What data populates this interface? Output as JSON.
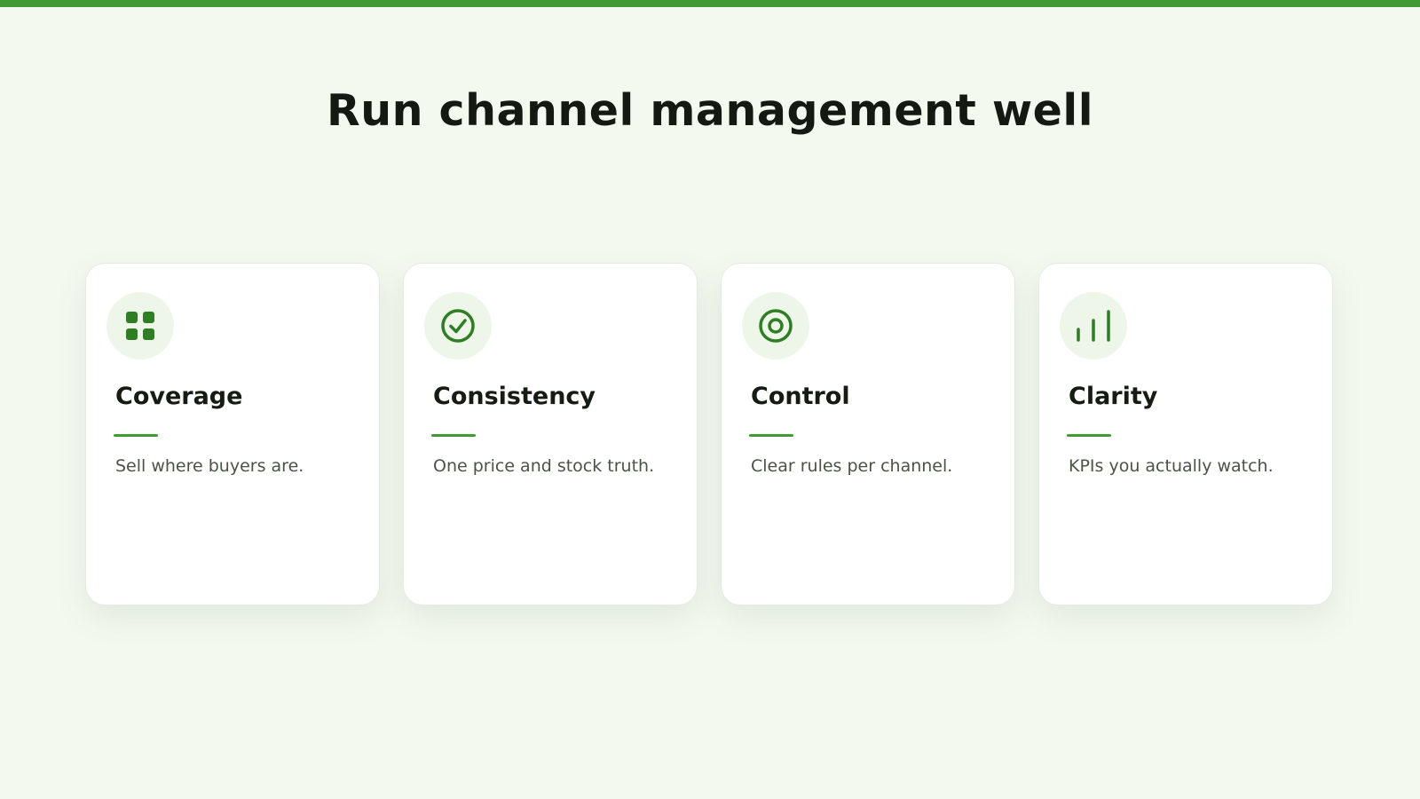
{
  "page": {
    "title": "Run channel management well",
    "accent_color": "#3f9b32"
  },
  "cards": [
    {
      "icon": "grid-icon",
      "title": "Coverage",
      "description": "Sell where buyers are."
    },
    {
      "icon": "check-circle-icon",
      "title": "Consistency",
      "description": "One price and stock truth."
    },
    {
      "icon": "target-icon",
      "title": "Control",
      "description": "Clear rules per channel."
    },
    {
      "icon": "bar-chart-icon",
      "title": "Clarity",
      "description": "KPIs you actually watch."
    }
  ]
}
